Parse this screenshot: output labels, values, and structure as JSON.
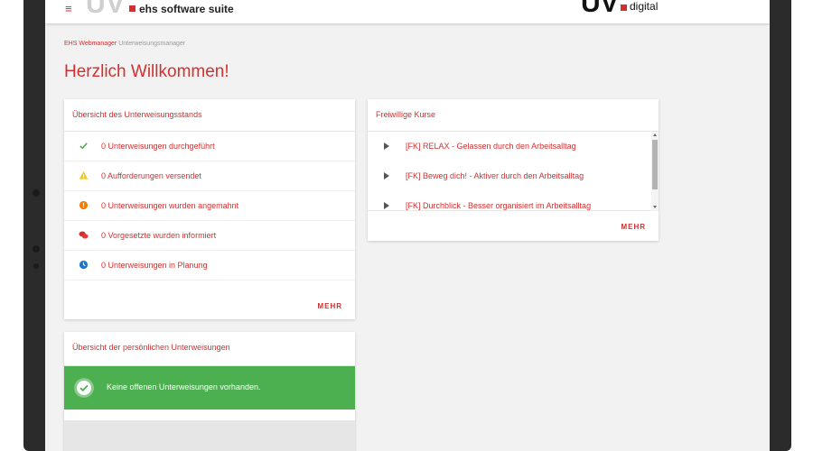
{
  "header": {
    "menu_icon": "menu-icon",
    "brand_mark": "UV",
    "brand_text": "ehs software suite",
    "logo_mark": "UV",
    "logo_text": "digital"
  },
  "breadcrumb": {
    "link": "EHS Webmanager",
    "current": "Unterweisungsmanager"
  },
  "page_title": "Herzlich Willkommen!",
  "training_status": {
    "title": "Übersicht des Unterweisungsstands",
    "items": [
      {
        "text": "0 Unterweisungen durchgeführt",
        "icon": "check-icon",
        "color": "#4caf50"
      },
      {
        "text": "0 Aufforderungen versendet",
        "icon": "warning-icon",
        "color": "#f5c518"
      },
      {
        "text": "0 Unterweisungen wurden angemahnt",
        "icon": "alert-icon",
        "color": "#f57c00"
      },
      {
        "text": "0 Vorgesetzte wurden informiert",
        "icon": "chat-icon",
        "color": "#d32f2f"
      },
      {
        "text": "0 Unterweisungen in Planung",
        "icon": "clock-icon",
        "color": "#1976d2"
      }
    ],
    "more_label": "MEHR"
  },
  "voluntary_courses": {
    "title": "Freiwillige Kurse",
    "items": [
      "[FK] RELAX - Gelassen durch den Arbeitsalltag",
      "[FK] Beweg dich! - Aktiver durch den Arbeitsalltag",
      "[FK] Durchblick - Besser organisiert im Arbeitsalltag"
    ],
    "more_label": "MEHR"
  },
  "personal_training": {
    "title": "Übersicht der persönlichen Unterweisungen",
    "success_message": "Keine offenen Unterweisungen vorhanden."
  },
  "colors": {
    "accent": "#d32f2f",
    "success": "#4caf50"
  }
}
